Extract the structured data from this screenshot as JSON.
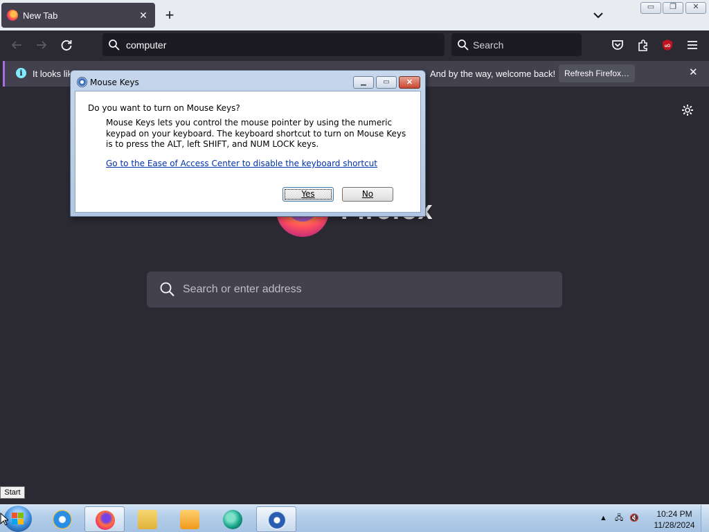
{
  "browser": {
    "tab": {
      "title": "New Tab"
    },
    "url_value": "computer",
    "search_placeholder": "Search",
    "notification": {
      "text_left": "It looks like",
      "text_right": "And by the way, welcome back!",
      "refresh_label": "Refresh Firefox…"
    },
    "newtab": {
      "wordmark": "Firefox",
      "search_placeholder": "Search or enter address"
    }
  },
  "dialog": {
    "title": "Mouse Keys",
    "question": "Do you want to turn on Mouse Keys?",
    "description": "Mouse Keys lets you control the mouse pointer by using the numeric keypad on your keyboard.  The keyboard shortcut to turn on Mouse Keys is to press the ALT, left SHIFT, and NUM LOCK keys.",
    "link": "Go to the Ease of Access Center to disable the keyboard shortcut",
    "yes_label": "Yes",
    "no_label": "No"
  },
  "taskbar": {
    "start_tooltip": "Start",
    "time": "10:24 PM",
    "date": "11/28/2024",
    "pinned": [
      {
        "icon": "internet-explorer-icon"
      },
      {
        "icon": "firefox-icon",
        "active": true
      },
      {
        "icon": "file-explorer-icon"
      },
      {
        "icon": "media-player-icon"
      },
      {
        "icon": "green-app-icon"
      },
      {
        "icon": "ease-of-access-icon",
        "active": true
      }
    ]
  },
  "colors": {
    "chrome_dark": "#2b2a33",
    "field_dark": "#1c1b22",
    "notif_bg": "#42414d",
    "link": "#0033aa"
  }
}
